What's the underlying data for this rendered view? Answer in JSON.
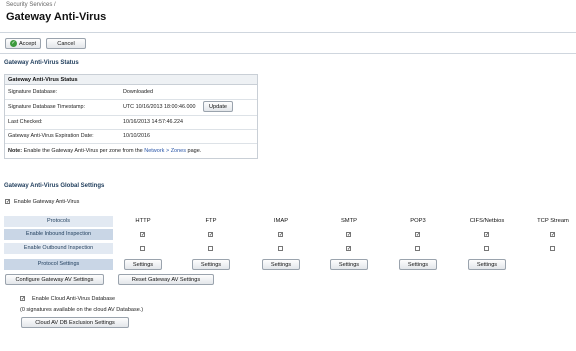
{
  "breadcrumb": "Security Services /",
  "page_title": "Gateway Anti-Virus",
  "toolbar": {
    "accept_label": "Accept",
    "cancel_label": "Cancel"
  },
  "status_section": {
    "title": "Gateway Anti-Virus Status",
    "box_title": "Gateway Anti-Virus Status",
    "rows": [
      {
        "label": "Signature Database:",
        "value": "Downloaded"
      },
      {
        "label": "Signature Database Timestamp:",
        "value": "UTC 10/16/2013 18:00:46.000",
        "button": "Update"
      },
      {
        "label": "Last Checked:",
        "value": "10/16/2013 14:57:46.224"
      },
      {
        "label": "Gateway Anti-Virus Expiration Date:",
        "value": "10/10/2016"
      }
    ],
    "note": {
      "prefix": "Note:",
      "text": " Enable the Gateway Anti-Virus per zone from the ",
      "link": "Network > Zones",
      "suffix": " page."
    }
  },
  "global_section": {
    "title": "Gateway Anti-Virus Global Settings",
    "enable_label": "Enable Gateway Anti-Virus",
    "enable_checked": true,
    "protocols_header": "Protocols",
    "protocols": [
      "HTTP",
      "FTP",
      "IMAP",
      "SMTP",
      "POP3",
      "CIFS/Netbios",
      "TCP Stream"
    ],
    "inbound_label": "Enable Inbound Inspection",
    "inbound": [
      true,
      true,
      true,
      true,
      true,
      true,
      true
    ],
    "outbound_label": "Enable Outbound Inspection",
    "outbound": [
      false,
      false,
      false,
      true,
      false,
      false,
      false
    ],
    "settings_row_label": "Protocol Settings",
    "settings_button": "Settings",
    "configure_button": "Configure Gateway AV Settings",
    "reset_button": "Reset Gateway AV Settings"
  },
  "cloud": {
    "enable_label": "Enable Cloud Anti-Virus Database",
    "enable_checked": true,
    "note": "(0 signatures available on the cloud AV Database.)",
    "exclusion_button": "Cloud AV DB Exclusion Settings"
  }
}
